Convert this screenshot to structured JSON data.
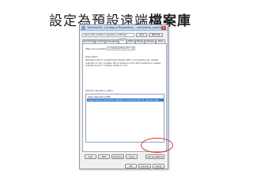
{
  "slide": {
    "title_plain": "設定為預設遠端",
    "title_bold": "檔案庫"
  },
  "window": {
    "title": "TortoiseGit: Configure Repository - netcontrol_solution",
    "close_glyph": "×",
    "repo_select": "netcontrol_solution repository settings",
    "top_buttons": [
      "Add",
      "Edit file"
    ],
    "tabs": [
      "Commands",
      "Context",
      "Changelog",
      "Sync",
      "Fetch",
      "Merge",
      "Rebase",
      "Push"
    ],
    "active_tab": "Sync",
    "after_pull_label": "After pull operation:",
    "after_pull_value": "<compare Branch>",
    "description_label": "Description:",
    "description": "Operation which is performed directly after a successful pull. update requires no pull / update, fetch requires no the fetch extension, rebase requires to pull = rebase. Default: none",
    "remotes_label": "Remote repository paths:",
    "remotes": [
      "Alias: Repository Path",
      "origin: https://netcontrol.netfusion.com/netcontrol_fs_solution.repo"
    ],
    "action_buttons": [
      "Add",
      "Edit",
      "Remove",
      "Copy",
      "Set as default"
    ],
    "footer_buttons": [
      "OK",
      "Cancel",
      "Apply"
    ]
  }
}
